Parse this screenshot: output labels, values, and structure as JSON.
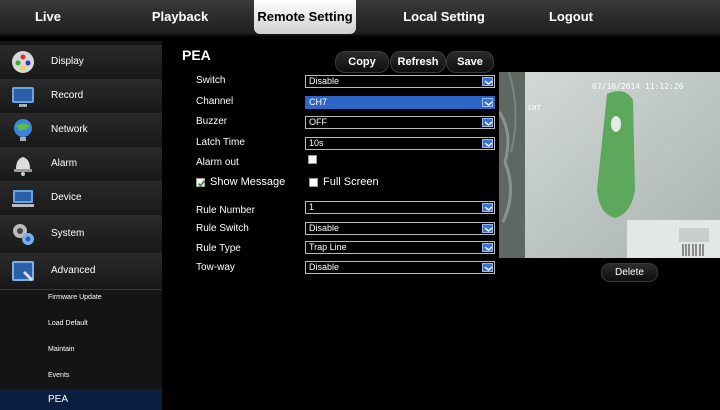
{
  "nav": {
    "tabs": [
      {
        "label": "Live"
      },
      {
        "label": "Playback"
      },
      {
        "label": "Remote Setting",
        "active": true
      },
      {
        "label": "Local Setting"
      },
      {
        "label": "Logout"
      }
    ]
  },
  "sidebar": {
    "items": [
      {
        "label": "Display",
        "icon": "display-icon"
      },
      {
        "label": "Record",
        "icon": "record-icon"
      },
      {
        "label": "Network",
        "icon": "network-icon"
      },
      {
        "label": "Alarm",
        "icon": "alarm-icon"
      },
      {
        "label": "Device",
        "icon": "device-icon"
      },
      {
        "label": "System",
        "icon": "system-icon"
      },
      {
        "label": "Advanced",
        "icon": "advanced-icon"
      }
    ],
    "sub_items": [
      {
        "label": "Firmware Update"
      },
      {
        "label": "Load Default"
      },
      {
        "label": "Maintain"
      },
      {
        "label": "Events"
      },
      {
        "label": "PEA",
        "active": true
      }
    ]
  },
  "main": {
    "title": "PEA",
    "buttons": {
      "copy": "Copy",
      "refresh": "Refresh",
      "save": "Save"
    },
    "fields": {
      "switch": {
        "label": "Switch",
        "value": "Disable"
      },
      "channel": {
        "label": "Channel",
        "value": "CH7"
      },
      "buzzer": {
        "label": "Buzzer",
        "value": "OFF"
      },
      "latch_time": {
        "label": "Latch Time",
        "value": "10s"
      },
      "alarm_out": {
        "label": "Alarm out",
        "checked": false
      },
      "show_message": {
        "label": "Show Message",
        "checked": true
      },
      "full_screen": {
        "label": "Full Screen",
        "checked": false
      },
      "rule_number": {
        "label": "Rule Number",
        "value": "1"
      },
      "rule_switch": {
        "label": "Rule Switch",
        "value": "Disable"
      },
      "rule_type": {
        "label": "Rule Type",
        "value": "Trap Line"
      },
      "tow_way": {
        "label": "Tow-way",
        "value": "Disable"
      }
    },
    "preview": {
      "timestamp": "07/10/2014 11:12:26",
      "channel": "CH7",
      "delete_label": "Delete"
    }
  },
  "colors": {
    "accent": "#2f66c6",
    "active_sub": "#0a1e40"
  }
}
